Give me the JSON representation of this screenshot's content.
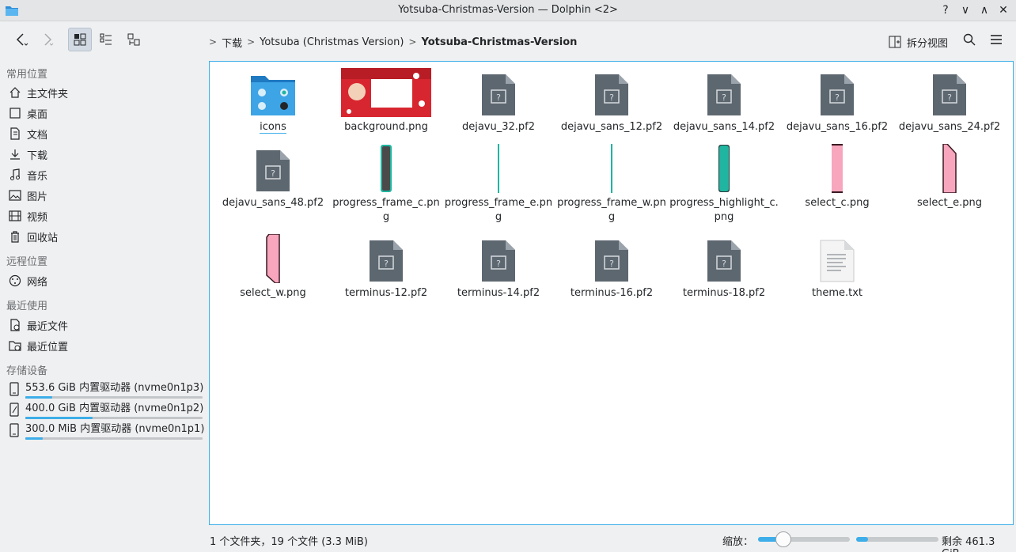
{
  "window": {
    "title": "Yotsuba-Christmas-Version — Dolphin <2>",
    "help_icon": "?",
    "minimize_icon": "∨",
    "maximize_icon": "∧",
    "close_icon": "✕"
  },
  "toolbar": {
    "breadcrumb": [
      "下载",
      "Yotsuba (Christmas Version)",
      "Yotsuba-Christmas-Version"
    ],
    "split_label": "拆分视图"
  },
  "sidebar": {
    "sections": {
      "places": "常用位置",
      "remote": "远程位置",
      "recent": "最近使用",
      "devices": "存储设备"
    },
    "places": [
      {
        "label": "主文件夹",
        "icon": "home-icon"
      },
      {
        "label": "桌面",
        "icon": "desktop-icon"
      },
      {
        "label": "文档",
        "icon": "documents-icon"
      },
      {
        "label": "下载",
        "icon": "downloads-icon"
      },
      {
        "label": "音乐",
        "icon": "music-icon"
      },
      {
        "label": "图片",
        "icon": "pictures-icon"
      },
      {
        "label": "视频",
        "icon": "videos-icon"
      },
      {
        "label": "回收站",
        "icon": "trash-icon"
      }
    ],
    "remote": [
      {
        "label": "网络",
        "icon": "network-icon"
      }
    ],
    "recent": [
      {
        "label": "最近文件",
        "icon": "recent-files-icon"
      },
      {
        "label": "最近位置",
        "icon": "recent-locations-icon"
      }
    ],
    "devices": [
      {
        "label": "553.6 GiB 内置驱动器 (nvme0n1p3)",
        "usage": 0.15
      },
      {
        "label": "400.0 GiB 内置驱动器 (nvme0n1p2)",
        "usage": 0.38
      },
      {
        "label": "300.0 MiB 内置驱动器 (nvme0n1p1)",
        "usage": 0.1
      }
    ]
  },
  "files": [
    {
      "name": "icons",
      "kind": "folder"
    },
    {
      "name": "background.png",
      "kind": "image-bg"
    },
    {
      "name": "dejavu_32.pf2",
      "kind": "unknown"
    },
    {
      "name": "dejavu_sans_12.pf2",
      "kind": "unknown"
    },
    {
      "name": "dejavu_sans_14.pf2",
      "kind": "unknown"
    },
    {
      "name": "dejavu_sans_16.pf2",
      "kind": "unknown"
    },
    {
      "name": "dejavu_sans_24.pf2",
      "kind": "unknown"
    },
    {
      "name": "dejavu_sans_48.pf2",
      "kind": "unknown"
    },
    {
      "name": "progress_frame_c.png",
      "kind": "frame-c"
    },
    {
      "name": "progress_frame_e.png",
      "kind": "line"
    },
    {
      "name": "progress_frame_w.png",
      "kind": "line"
    },
    {
      "name": "progress_highlight_c.png",
      "kind": "highlight"
    },
    {
      "name": "select_c.png",
      "kind": "select-c"
    },
    {
      "name": "select_e.png",
      "kind": "select-e"
    },
    {
      "name": "select_w.png",
      "kind": "select-w"
    },
    {
      "name": "terminus-12.pf2",
      "kind": "unknown"
    },
    {
      "name": "terminus-14.pf2",
      "kind": "unknown"
    },
    {
      "name": "terminus-16.pf2",
      "kind": "unknown"
    },
    {
      "name": "terminus-18.pf2",
      "kind": "unknown"
    },
    {
      "name": "theme.txt",
      "kind": "text"
    }
  ],
  "status": {
    "summary": "1 个文件夹，19 个文件 (3.3 MiB)",
    "zoom_label": "缩放：",
    "zoom": 0.28,
    "free_space": "剩余 461.3 GiB",
    "used": 0.14
  },
  "colors": {
    "accent": "#3daee9",
    "file_icon": "#5d6770",
    "teal": "#1fb5a0",
    "pink": "#f7a6be"
  }
}
